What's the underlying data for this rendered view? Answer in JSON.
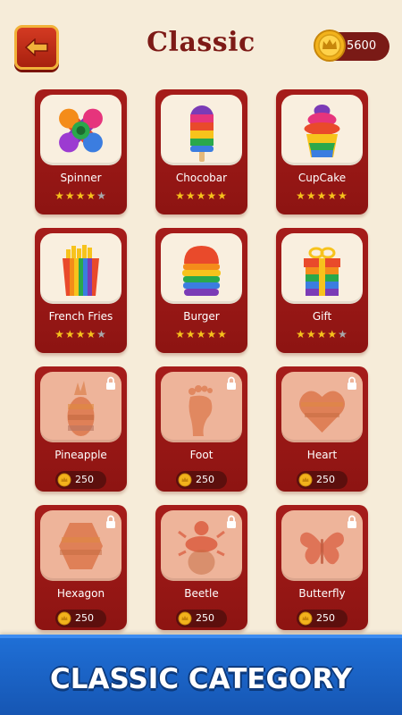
{
  "header": {
    "title": "Classic",
    "coins": "5600"
  },
  "levels": [
    {
      "name": "Spinner",
      "stars": 4,
      "icon": "spinner-icon"
    },
    {
      "name": "Chocobar",
      "stars": 5,
      "icon": "chocobar-icon"
    },
    {
      "name": "CupCake",
      "stars": 5,
      "icon": "cupcake-icon"
    },
    {
      "name": "French Fries",
      "stars": 4,
      "icon": "french-fries-icon"
    },
    {
      "name": "Burger",
      "stars": 5,
      "icon": "burger-icon"
    },
    {
      "name": "Gift",
      "stars": 4,
      "icon": "gift-icon"
    },
    {
      "name": "Pineapple",
      "price": "250",
      "locked": true,
      "icon": "pineapple-icon"
    },
    {
      "name": "Foot",
      "price": "250",
      "locked": true,
      "icon": "foot-icon"
    },
    {
      "name": "Heart",
      "price": "250",
      "locked": true,
      "icon": "heart-icon"
    },
    {
      "name": "Hexagon",
      "price": "250",
      "locked": true,
      "icon": "hexagon-icon"
    },
    {
      "name": "Beetle",
      "price": "250",
      "locked": true,
      "icon": "beetle-icon"
    },
    {
      "name": "Butterfly",
      "price": "250",
      "locked": true,
      "icon": "butterfly-icon"
    }
  ],
  "banner": {
    "text": "CLASSIC CATEGORY"
  },
  "colors": {
    "card": "#a61c1a",
    "title": "#7d1a16",
    "star": "#f6c21c",
    "banner": "#1f6fd6"
  }
}
